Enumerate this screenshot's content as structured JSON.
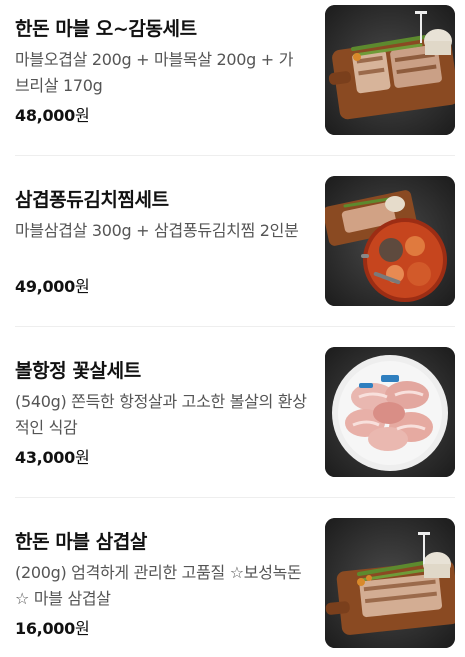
{
  "products": [
    {
      "title": "한돈 마블 오~감동세트",
      "description": "마블오겹살 200g + 마블목살 200g + 가브리살 170g",
      "price": "48,000",
      "currency": "원",
      "image_icon": "pork-board-image"
    },
    {
      "title": "삼겹퐁듀김치찜세트",
      "description": "마블삼겹살 300g + 삼겹퐁듀김치찜 2인분",
      "price": "49,000",
      "currency": "원",
      "image_icon": "kimchi-stew-image"
    },
    {
      "title": "볼항정 꽃살세트",
      "description": "(540g) 쫀득한 항정살과 고소한 볼살의 환상적인 식감",
      "price": "43,000",
      "currency": "원",
      "image_icon": "pork-plate-image"
    },
    {
      "title": "한돈 마블 삼겹살",
      "description": "(200g) 엄격하게 관리한 고품질 ☆보성녹돈☆ 마블 삼겹살",
      "price": "16,000",
      "currency": "원",
      "image_icon": "pork-board-image"
    }
  ]
}
